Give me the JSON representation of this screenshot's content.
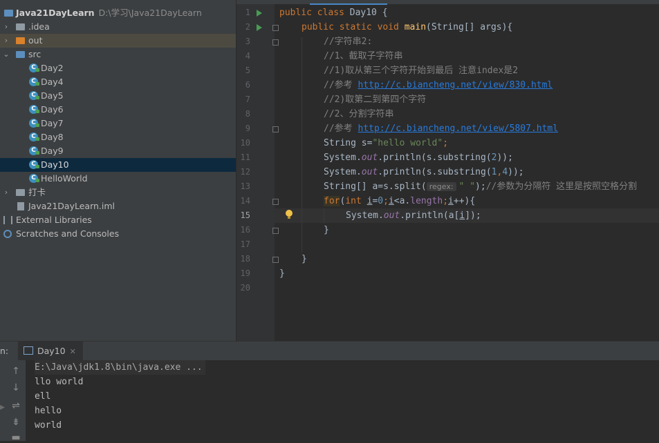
{
  "project": {
    "root_name": "Java21DayLearn",
    "root_path": "D:\\学习\\Java21DayLearn",
    "items": [
      {
        "label": ".idea",
        "kind": "folder"
      },
      {
        "label": "out",
        "kind": "folder-excluded"
      },
      {
        "label": "src",
        "kind": "folder-source"
      },
      {
        "label": "Day2",
        "kind": "class"
      },
      {
        "label": "Day4",
        "kind": "class"
      },
      {
        "label": "Day5",
        "kind": "class"
      },
      {
        "label": "Day6",
        "kind": "class"
      },
      {
        "label": "Day7",
        "kind": "class"
      },
      {
        "label": "Day8",
        "kind": "class"
      },
      {
        "label": "Day9",
        "kind": "class"
      },
      {
        "label": "Day10",
        "kind": "class",
        "selected": true
      },
      {
        "label": "HelloWorld",
        "kind": "class"
      },
      {
        "label": "打卡",
        "kind": "folder"
      },
      {
        "label": "Java21DayLearn.iml",
        "kind": "file"
      },
      {
        "label": "External Libraries",
        "kind": "libraries"
      },
      {
        "label": "Scratches and Consoles",
        "kind": "scratches"
      }
    ]
  },
  "editor": {
    "current_line": 15,
    "line_numbers": [
      "1",
      "2",
      "3",
      "4",
      "5",
      "6",
      "7",
      "8",
      "9",
      "10",
      "11",
      "12",
      "13",
      "14",
      "15",
      "16",
      "17",
      "18",
      "19",
      "20"
    ],
    "lines": {
      "l1_kw": "public class ",
      "l1_name": "Day10 {",
      "l2_kw1": "public static void ",
      "l2_fn": "main",
      "l2_rest": "(String[] args){",
      "l3": "//字符串2:",
      "l4": "//1、截取子字符串",
      "l5": "//1)取从第三个字符开始到最后 注意index是2",
      "l6_pre": "//参考 ",
      "l6_link": "http://c.biancheng.net/view/830.html",
      "l7": "//2)取第二到第四个字符",
      "l8": "//2、分割字符串",
      "l9_pre": "//参考 ",
      "l9_link": "http://c.biancheng.net/view/5807.html",
      "l10_a": "String s=",
      "l10_str": "\"hello world\"",
      "l10_end": ";",
      "l11_a": "System.",
      "l11_out": "out",
      "l11_b": ".println(s.substring(",
      "l11_n": "2",
      "l11_c": "));",
      "l12_a": "System.",
      "l12_out": "out",
      "l12_b": ".println(s.substring(",
      "l12_n1": "1",
      "l12_comma": ",",
      "l12_n2": "4",
      "l12_c": "));",
      "l13_a": "String[] a=s.split(",
      "l13_hint": "regex:",
      "l13_str": "\" \"",
      "l13_b": ");",
      "l13_cm": "//参数为分隔符 这里是按照空格分割",
      "l14_for": "for",
      "l14_p": "(",
      "l14_int": "int ",
      "l14_i1": "i",
      "l14_eq": "=",
      "l14_zero": "0",
      "l14_semi1": ";",
      "l14_i2": "i",
      "l14_lt": "<a.",
      "l14_len": "length",
      "l14_semi2": ";",
      "l14_i3": "i",
      "l14_end": "++){",
      "l15_a": "System.",
      "l15_out": "out",
      "l15_b": ".println(a[",
      "l15_i": "i",
      "l15_c": "]);",
      "l16": "}",
      "l18": "}",
      "l19": "}"
    }
  },
  "run": {
    "prefix": "n:",
    "tab_label": "Day10",
    "output": [
      "E:\\Java\\jdk1.8\\bin\\java.exe ...",
      "llo world",
      "ell",
      "hello",
      "world"
    ]
  },
  "colors": {
    "keyword": "#cc7832",
    "comment": "#808080",
    "string": "#6a8759",
    "number": "#6897bb",
    "link": "#287bde",
    "selection": "#0d293e"
  }
}
